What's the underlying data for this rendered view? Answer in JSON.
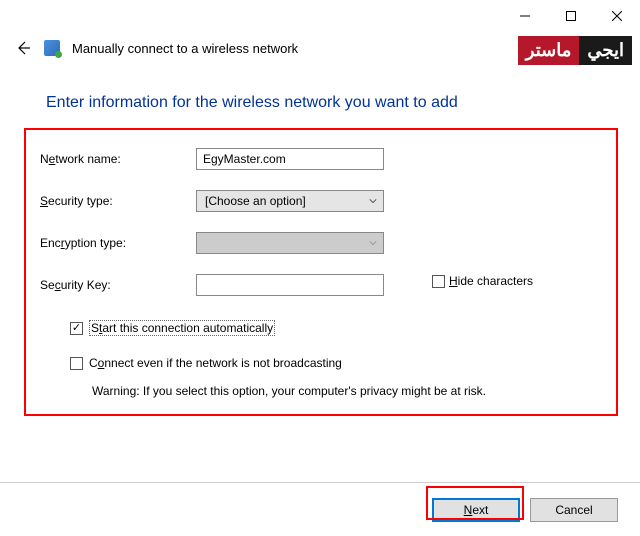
{
  "titlebar": {
    "minimize": "Minimize",
    "maximize": "Maximize",
    "close": "Close"
  },
  "header": {
    "back": "Back",
    "title": "Manually connect to a wireless network"
  },
  "badge": {
    "dark": "ايجي",
    "red": "ماستر"
  },
  "instruction": "Enter information for the wireless network you want to add",
  "form": {
    "network_name_label": "Network name:",
    "network_name_value": "EgyMaster.com",
    "security_type_label": "Security type:",
    "security_type_value": "[Choose an option]",
    "encryption_type_label": "Encryption type:",
    "encryption_type_value": "",
    "security_key_label": "Security Key:",
    "security_key_value": "",
    "hide_chars": "Hide characters",
    "auto_start": "Start this connection automatically",
    "connect_hidden": "Connect even if the network is not broadcasting",
    "warning": "Warning: If you select this option, your computer's privacy might be at risk."
  },
  "buttons": {
    "next": "Next",
    "cancel": "Cancel"
  }
}
